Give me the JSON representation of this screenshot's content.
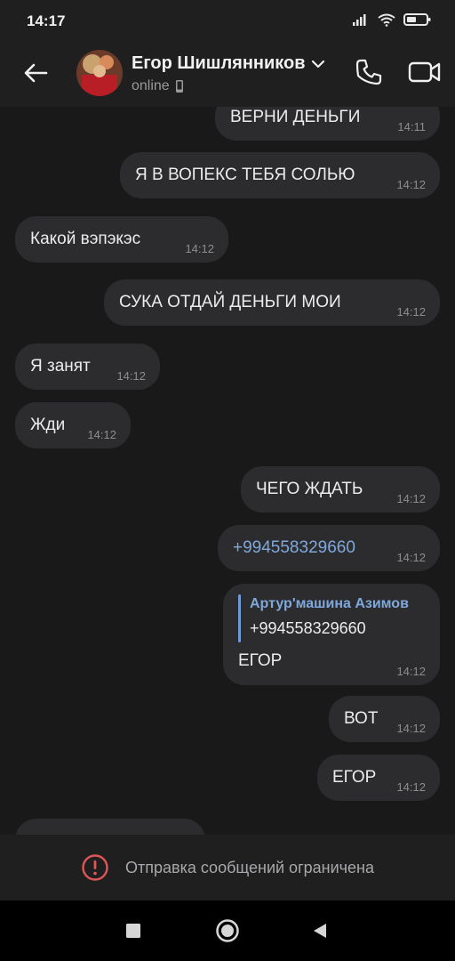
{
  "status_bar": {
    "time": "14:17",
    "icons": [
      "signal-icon",
      "wifi-icon",
      "battery-icon"
    ]
  },
  "header": {
    "contact_name": "Егор Шишлянников",
    "contact_status": "online",
    "icons": [
      "back-arrow-icon",
      "chevron-down-icon",
      "phone-icon",
      "video-icon",
      "mobile-device-icon"
    ]
  },
  "messages": [
    {
      "direction": "outgoing",
      "text": "ВЕРНИ ДЕНЬГИ",
      "time": "14:11"
    },
    {
      "direction": "outgoing",
      "text": "Я В ВОПЕКС ТЕБЯ СОЛЬЮ",
      "time": "14:12"
    },
    {
      "direction": "incoming",
      "text": "Какой вэпэкэс",
      "time": "14:12"
    },
    {
      "direction": "outgoing",
      "text": "СУКА ОТДАЙ ДЕНЬГИ МОИ",
      "time": "14:12"
    },
    {
      "direction": "incoming",
      "text": "Я занят",
      "time": "14:12"
    },
    {
      "direction": "incoming",
      "text": "Жди",
      "time": "14:12"
    },
    {
      "direction": "outgoing",
      "text": "ЧЕГО ЖДАТЬ",
      "time": "14:12"
    },
    {
      "direction": "outgoing",
      "text": "+994558329660",
      "time": "14:12",
      "is_link": true
    },
    {
      "direction": "outgoing",
      "reply_author": "Артур'машина Азимов",
      "reply_text": "+994558329660",
      "text": "ЕГОР",
      "time": "14:12"
    },
    {
      "direction": "outgoing",
      "text": "ВОТ",
      "time": "14:12"
    },
    {
      "direction": "outgoing",
      "text": "ЕГОР",
      "time": "14:12"
    }
  ],
  "footer": {
    "restriction_text": "Отправка сообщений ограничена",
    "icon": "warning-circle-icon"
  },
  "nav_bar": {
    "icons": [
      "recents-square-icon",
      "home-circle-icon",
      "back-triangle-icon"
    ]
  },
  "colors": {
    "background": "#19191a",
    "bubble": "#2c2c2e",
    "link": "#7fa8dc",
    "warning": "#e05656"
  }
}
